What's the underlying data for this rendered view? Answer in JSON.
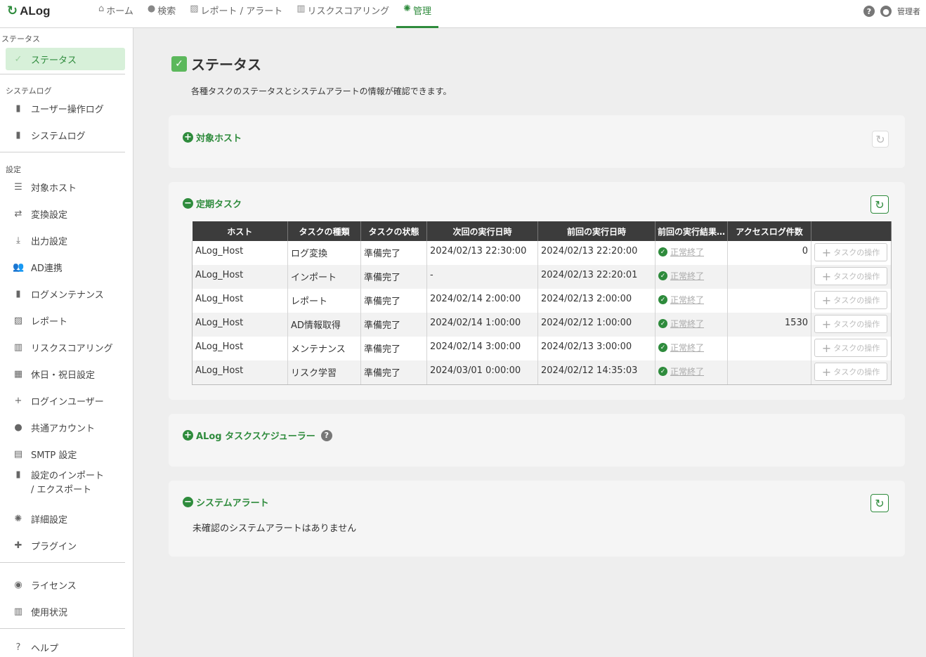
{
  "app": {
    "logo_mark": "↻",
    "logo_text": "ALog"
  },
  "nav": [
    {
      "icon": "⌂",
      "label": "ホーム"
    },
    {
      "icon": "●",
      "label": "検索"
    },
    {
      "icon": "▨",
      "label": "レポート / アラート"
    },
    {
      "icon": "▥",
      "label": "リスクスコアリング"
    },
    {
      "icon": "✺",
      "label": "管理"
    }
  ],
  "header": {
    "help": "?",
    "user": "管理者"
  },
  "sidebar": {
    "sections": {
      "status": "ステータス",
      "syslog": "システムログ",
      "settings": "設定"
    },
    "items": [
      {
        "icon": "✓",
        "label": "ステータス"
      },
      {
        "icon": "▮",
        "label": "ユーザー操作ログ"
      },
      {
        "icon": "▮",
        "label": "システムログ"
      },
      {
        "icon": "☰",
        "label": "対象ホスト"
      },
      {
        "icon": "⇄",
        "label": "変換設定"
      },
      {
        "icon": "⤓",
        "label": "出力設定"
      },
      {
        "icon": "👥",
        "label": "AD連携"
      },
      {
        "icon": "▮",
        "label": "ログメンテナンス"
      },
      {
        "icon": "▨",
        "label": "レポート"
      },
      {
        "icon": "▥",
        "label": "リスクスコアリング"
      },
      {
        "icon": "▦",
        "label": "休日・祝日設定"
      },
      {
        "icon": "+",
        "label": "ログインユーザー"
      },
      {
        "icon": "●",
        "label": "共通アカウント"
      },
      {
        "icon": "▤",
        "label": "SMTP 設定"
      },
      {
        "icon": "▮",
        "label": "設定のインポート",
        "label2": "/ エクスポート"
      },
      {
        "icon": "✺",
        "label": "詳細設定"
      },
      {
        "icon": "✚",
        "label": "プラグイン"
      },
      {
        "icon": "◉",
        "label": "ライセンス"
      },
      {
        "icon": "▥",
        "label": "使用状況"
      },
      {
        "icon": "?",
        "label": "ヘルプ"
      }
    ]
  },
  "main": {
    "title": "ステータス",
    "description": "各種タスクのステータスとシステムアラートの情報が確認できます。",
    "panels": {
      "hosts": {
        "title": "対象ホスト",
        "toggle": "+"
      },
      "tasks": {
        "title": "定期タスク",
        "toggle": "−"
      },
      "scheduler": {
        "title": "ALog タスクスケジューラー",
        "toggle": "+",
        "help": "?"
      },
      "alerts": {
        "title": "システムアラート",
        "toggle": "−",
        "message": "未確認のシステムアラートはありません"
      }
    },
    "refresh_icon": "↻",
    "table": {
      "headers": [
        "ホスト",
        "タスクの種類",
        "タスクの状態",
        "次回の実行日時",
        "前回の実行日時",
        "前回の実行結果…",
        "アクセスログ件数",
        ""
      ],
      "op_label": "タスクの操作",
      "rows": [
        {
          "host": "ALog_Host",
          "type": "ログ変換",
          "state": "準備完了",
          "next": "2024/02/13 22:30:00",
          "prev": "2024/02/13 22:20:00",
          "result": "正常終了",
          "count": "0"
        },
        {
          "host": "ALog_Host",
          "type": "インポート",
          "state": "準備完了",
          "next": "-",
          "prev": "2024/02/13 22:20:01",
          "result": "正常終了",
          "count": ""
        },
        {
          "host": "ALog_Host",
          "type": "レポート",
          "state": "準備完了",
          "next": "2024/02/14 2:00:00",
          "prev": "2024/02/13 2:00:00",
          "result": "正常終了",
          "count": ""
        },
        {
          "host": "ALog_Host",
          "type": "AD情報取得",
          "state": "準備完了",
          "next": "2024/02/14 1:00:00",
          "prev": "2024/02/12 1:00:00",
          "result": "正常終了",
          "count": "1530"
        },
        {
          "host": "ALog_Host",
          "type": "メンテナンス",
          "state": "準備完了",
          "next": "2024/02/14 3:00:00",
          "prev": "2024/02/13 3:00:00",
          "result": "正常終了",
          "count": ""
        },
        {
          "host": "ALog_Host",
          "type": "リスク学習",
          "state": "準備完了",
          "next": "2024/03/01 0:00:00",
          "prev": "2024/02/12 14:35:03",
          "result": "正常終了",
          "count": ""
        }
      ]
    }
  }
}
